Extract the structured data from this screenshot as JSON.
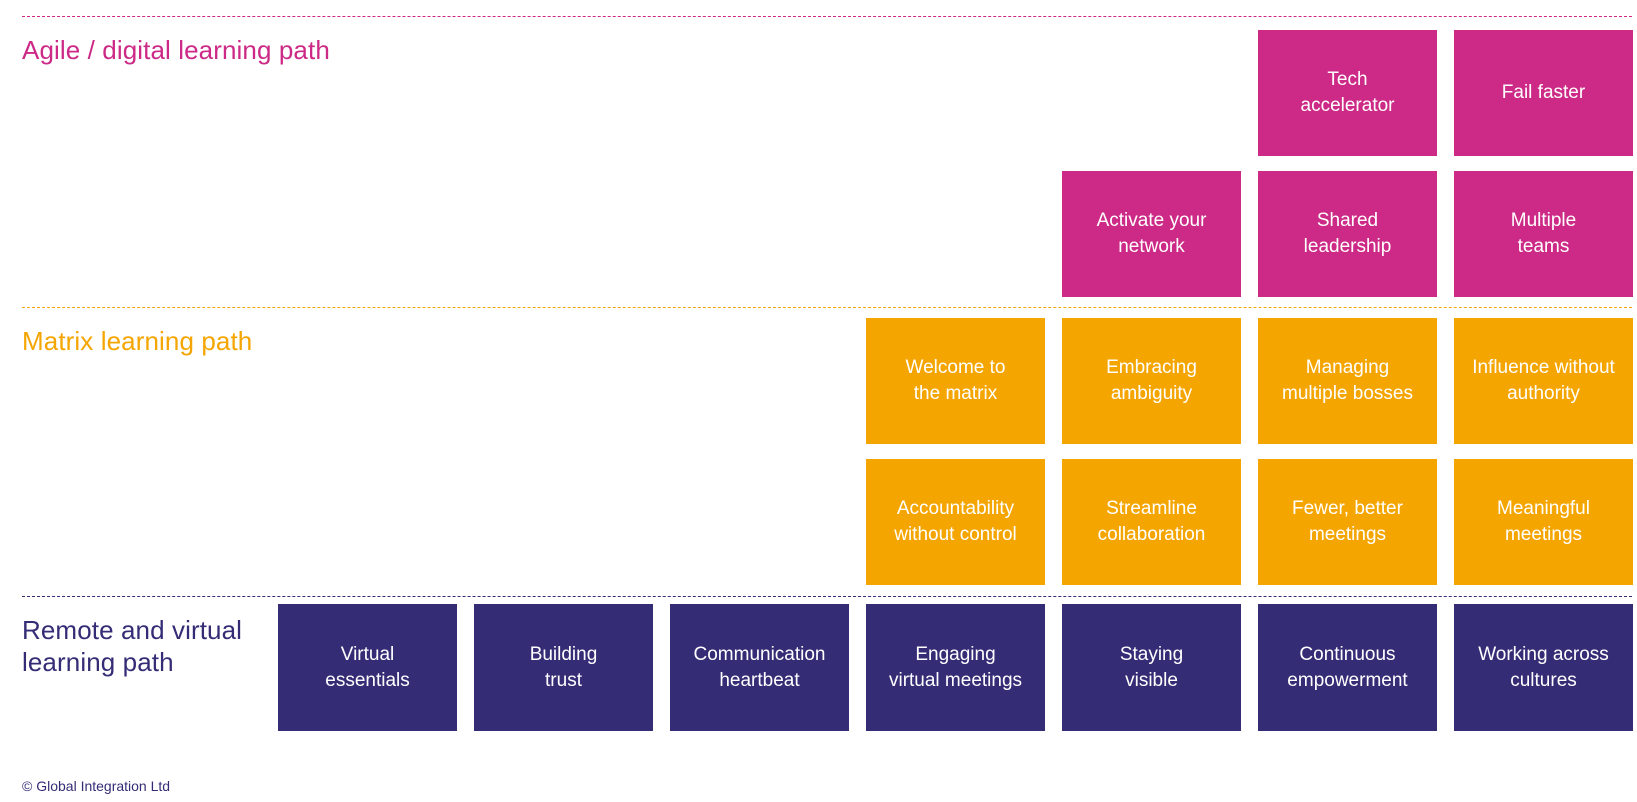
{
  "colors": {
    "agile": "#cc2a86",
    "matrix": "#f5a500",
    "remote": "#352c76",
    "tile_text": "#ffffff"
  },
  "sections": {
    "agile": {
      "title": "Agile / digital learning path",
      "tiles": [
        {
          "row": 1,
          "col": 6,
          "lines": [
            "Tech",
            "accelerator"
          ]
        },
        {
          "row": 1,
          "col": 7,
          "lines": [
            "Fail faster"
          ]
        },
        {
          "row": 2,
          "col": 5,
          "lines": [
            "Activate your",
            "network"
          ]
        },
        {
          "row": 2,
          "col": 6,
          "lines": [
            "Shared",
            "leadership"
          ]
        },
        {
          "row": 2,
          "col": 7,
          "lines": [
            "Multiple",
            "teams"
          ]
        }
      ]
    },
    "matrix": {
      "title": "Matrix learning path",
      "tiles": [
        {
          "row": 1,
          "col": 4,
          "lines": [
            "Welcome to",
            "the matrix"
          ]
        },
        {
          "row": 1,
          "col": 5,
          "lines": [
            "Embracing",
            "ambiguity"
          ]
        },
        {
          "row": 1,
          "col": 6,
          "lines": [
            "Managing",
            "multiple bosses"
          ]
        },
        {
          "row": 1,
          "col": 7,
          "lines": [
            "Influence without",
            "authority"
          ]
        },
        {
          "row": 2,
          "col": 4,
          "lines": [
            "Accountability",
            "without control"
          ]
        },
        {
          "row": 2,
          "col": 5,
          "lines": [
            "Streamline",
            "collaboration"
          ]
        },
        {
          "row": 2,
          "col": 6,
          "lines": [
            "Fewer, better",
            "meetings"
          ]
        },
        {
          "row": 2,
          "col": 7,
          "lines": [
            "Meaningful",
            "meetings"
          ]
        }
      ]
    },
    "remote": {
      "title": "Remote and virtual learning path",
      "tiles": [
        {
          "row": 1,
          "col": 1,
          "lines": [
            "Virtual",
            "essentials"
          ]
        },
        {
          "row": 1,
          "col": 2,
          "lines": [
            "Building",
            "trust"
          ]
        },
        {
          "row": 1,
          "col": 3,
          "lines": [
            "Communication",
            "heartbeat"
          ]
        },
        {
          "row": 1,
          "col": 4,
          "lines": [
            "Engaging",
            "virtual meetings"
          ]
        },
        {
          "row": 1,
          "col": 5,
          "lines": [
            "Staying",
            "visible"
          ]
        },
        {
          "row": 1,
          "col": 6,
          "lines": [
            "Continuous",
            "empowerment"
          ]
        },
        {
          "row": 1,
          "col": 7,
          "lines": [
            "Working across",
            "cultures"
          ]
        }
      ]
    }
  },
  "footer": {
    "copyright": "© Global Integration Ltd"
  }
}
